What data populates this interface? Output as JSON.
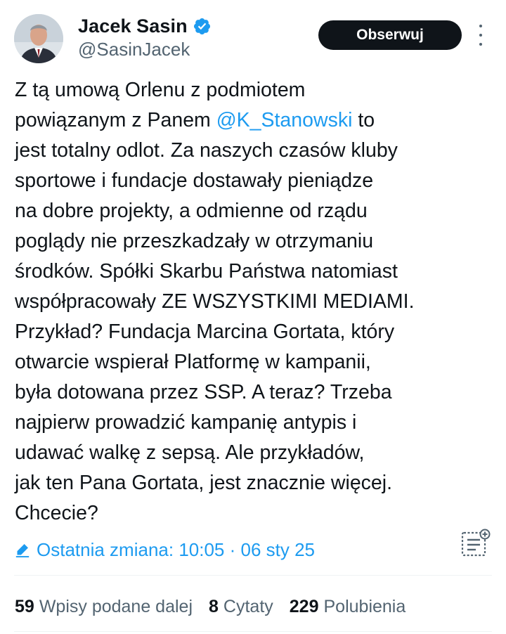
{
  "author": {
    "name": "Jacek Sasin",
    "handle": "@SasinJacek",
    "verified_icon": "verified-badge-icon"
  },
  "header": {
    "follow_label": "Obserwuj",
    "more_icon": "more-dots-icon"
  },
  "tweet": {
    "lines": [
      [
        "Z tą umową Orlenu z podmiotem"
      ],
      [
        "powiązanym z Panem ",
        "@K_Stanowski",
        " to"
      ],
      [
        "jest totalny odlot. Za naszych czasów kluby"
      ],
      [
        "sportowe i fundacje dostawały pieniądze"
      ],
      [
        "na dobre projekty, a odmienne od rządu"
      ],
      [
        "poglądy nie przeszkadzały w otrzymaniu"
      ],
      [
        "środków. Spółki Skarbu Państwa natomiast"
      ],
      [
        "współpracowały ZE WSZYSTKIMI MEDIAMI."
      ],
      [
        "Przykład? Fundacja Marcina Gortata, który"
      ],
      [
        "otwarcie wspierał Platformę w kampanii,"
      ],
      [
        "była dotowana przez SSP. A teraz? Trzeba"
      ],
      [
        "najpierw prowadzić kampanię antypis i"
      ],
      [
        "udawać walkę z sepsą. Ale przykładów,"
      ],
      [
        "jak ten Pana Gortata, jest znacznie więcej."
      ],
      [
        "Chcecie?"
      ]
    ],
    "mention": "@K_Stanowski"
  },
  "edit": {
    "label": "Ostatnia zmiana: 10:05 · 06 sty 25",
    "icon": "pencil-edit-icon"
  },
  "notes_icon": "community-notes-icon",
  "stats": {
    "reposts_count": "59",
    "reposts_label": "Wpisy podane dalej",
    "quotes_count": "8",
    "quotes_label": "Cytaty",
    "likes_count": "229",
    "likes_label": "Polubienia"
  },
  "colors": {
    "accent": "#1d9bf0",
    "text": "#0f1419",
    "secondary": "#536471",
    "button_bg": "#0f1419",
    "divider": "#eff3f4"
  }
}
